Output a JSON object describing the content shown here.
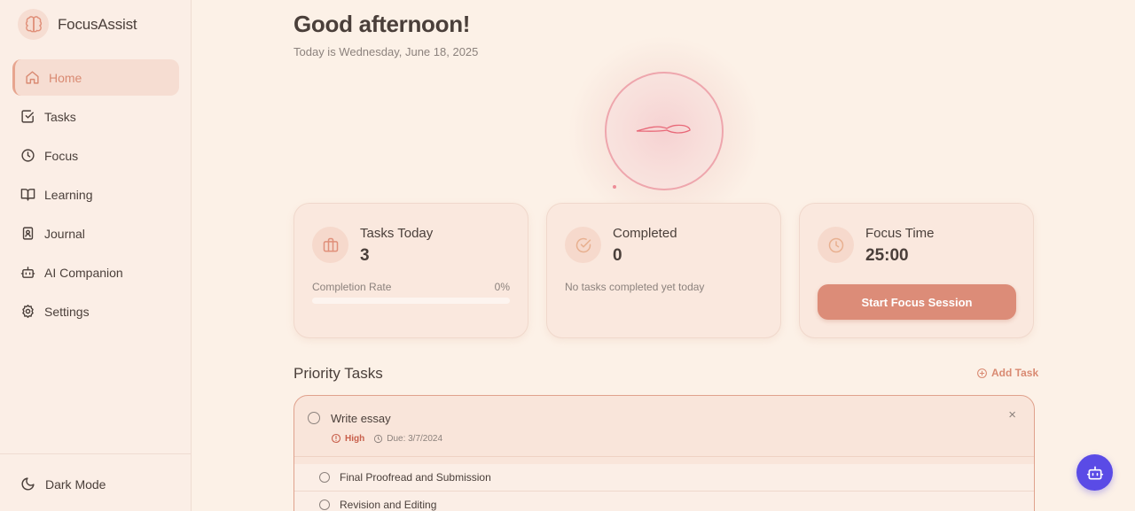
{
  "app": {
    "name": "FocusAssist"
  },
  "sidebar": {
    "items": [
      {
        "label": "Home",
        "icon": "home-icon",
        "active": true
      },
      {
        "label": "Tasks",
        "icon": "checkbox-icon"
      },
      {
        "label": "Focus",
        "icon": "clock-icon"
      },
      {
        "label": "Learning",
        "icon": "book-icon"
      },
      {
        "label": "Journal",
        "icon": "journal-icon"
      },
      {
        "label": "AI Companion",
        "icon": "robot-icon"
      },
      {
        "label": "Settings",
        "icon": "gear-icon"
      }
    ],
    "dark_mode_label": "Dark Mode"
  },
  "main": {
    "greeting": "Good afternoon!",
    "date_line": "Today is Wednesday, June 18, 2025",
    "stats": {
      "tasks_today": {
        "title": "Tasks Today",
        "value": "3",
        "rate_label": "Completion Rate",
        "rate_value": "0%",
        "rate_fraction": 0
      },
      "completed": {
        "title": "Completed",
        "value": "0",
        "note": "No tasks completed yet today"
      },
      "focus_time": {
        "title": "Focus Time",
        "value": "25:00",
        "button_label": "Start Focus Session"
      }
    },
    "priority": {
      "title": "Priority Tasks",
      "add_label": "Add Task",
      "task": {
        "title": "Write essay",
        "priority": "High",
        "due": "Due: 3/7/2024",
        "close": "×",
        "subtasks": [
          {
            "label": "Final Proofread and Submission"
          },
          {
            "label": "Revision and Editing"
          }
        ]
      }
    }
  },
  "colors": {
    "accent": "#dc8c78",
    "background": "#fcf1e7",
    "assistant_button": "#5a4be6",
    "priority_high": "#c85f4b"
  }
}
